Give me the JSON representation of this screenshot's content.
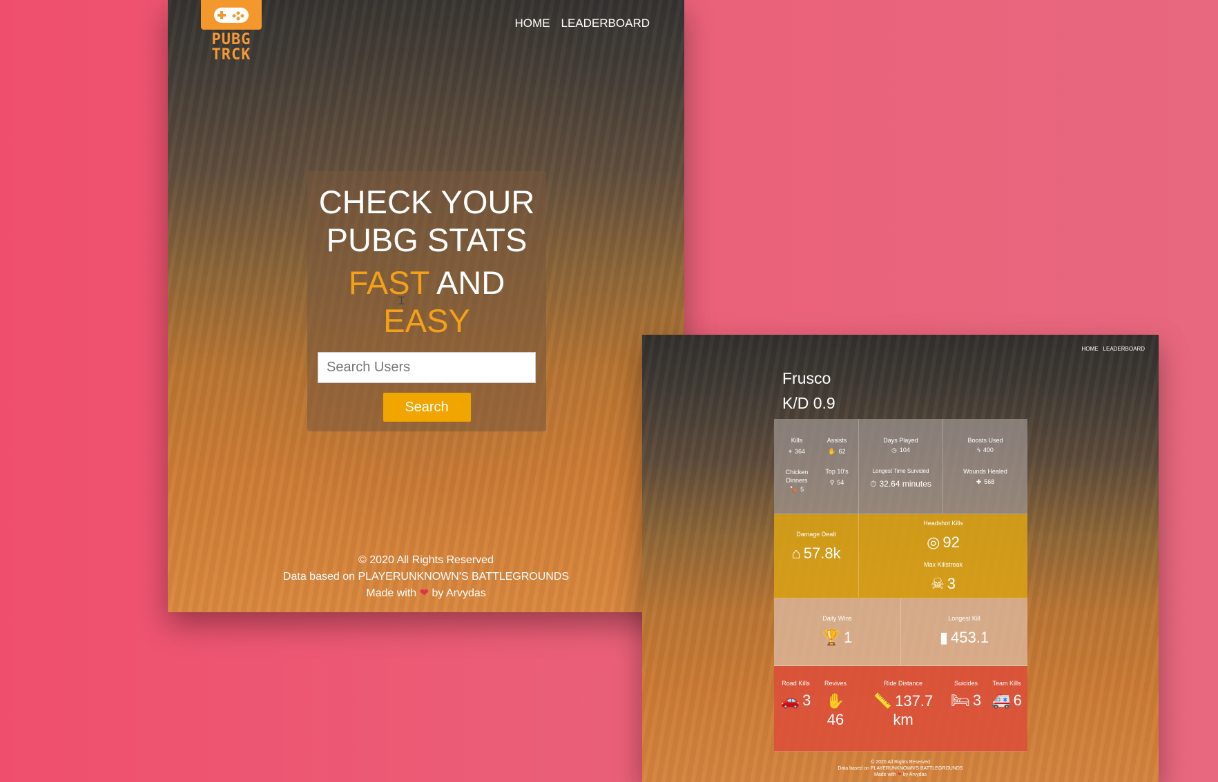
{
  "home": {
    "logo": {
      "text": "PUBG TRCK"
    },
    "nav": [
      "HOME",
      "LEADERBOARD"
    ],
    "hero": {
      "line1": "CHECK YOUR",
      "line2": "PUBG STATS",
      "fast": "FAST",
      "and": "AND",
      "easy": "EASY"
    },
    "search": {
      "placeholder": "Search Users",
      "button": "Search"
    },
    "footer": {
      "copyright": "© 2020 All Rights Reserved",
      "data_source": "Data based on PLAYERUNKNOWN'S BATTLEGROUNDS",
      "made_with": "Made with",
      "heart": "❤",
      "author": "by Arvydas"
    }
  },
  "profile": {
    "nav": [
      "HOME",
      "LEADERBOARD"
    ],
    "player": "Frusco",
    "kd": "K/D 0.9",
    "stats": {
      "kills": {
        "label": "Kills",
        "value": "364"
      },
      "assists": {
        "label": "Assists",
        "value": "62"
      },
      "chicken": {
        "label": "Chicken Dinners",
        "value": "5"
      },
      "top10": {
        "label": "Top 10's",
        "value": "54"
      },
      "days_played": {
        "label": "Days Played",
        "value": "104"
      },
      "longest_time": {
        "label": "Longest Time Survided",
        "value": "32.64 minutes"
      },
      "boosts": {
        "label": "Boosts Used",
        "value": "400"
      },
      "wounds": {
        "label": "Wounds Healed",
        "value": "568"
      },
      "damage": {
        "label": "Damage Dealt",
        "value": "57.8k"
      },
      "headshot": {
        "label": "Headshot Kills",
        "value": "92"
      },
      "killstreak": {
        "label": "Max Killstreak",
        "value": "3"
      },
      "daily_wins": {
        "label": "Daily Wins",
        "value": "1"
      },
      "longest_kill": {
        "label": "Longest Kill",
        "value": "453.1"
      },
      "road_kills": {
        "label": "Road Kills",
        "value": "3"
      },
      "revives": {
        "label": "Revives",
        "value": "46"
      },
      "ride_distance": {
        "label": "Ride Distance",
        "value": "137.7 km"
      },
      "suicides": {
        "label": "Suicides",
        "value": "3"
      },
      "team_kills": {
        "label": "Team Kills",
        "value": "6"
      }
    },
    "footer": {
      "copyright": "© 2020 All Rights Reserved",
      "data_source": "Data based on PLAYERUNKNOWN'S BATTLEGROUNDS",
      "made_with": "Made with",
      "heart": "❤",
      "author": "by Arvydas"
    }
  },
  "colors": {
    "page_bg": "#ec5672",
    "accent": "#f3a118",
    "logo": "#f4972d"
  }
}
